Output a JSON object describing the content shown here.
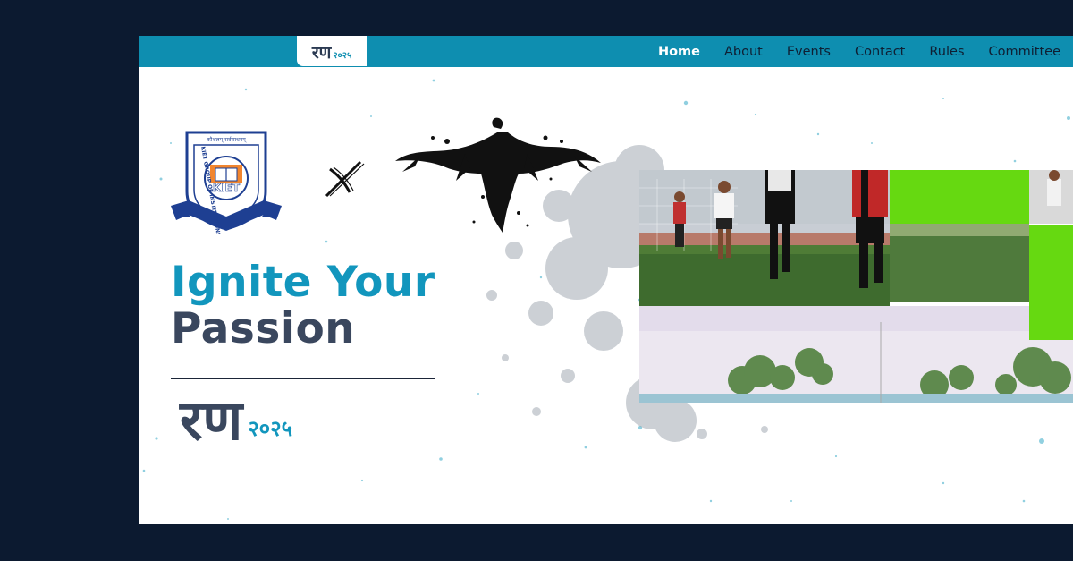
{
  "brand": {
    "name_main": "रण",
    "name_year": "२०२५"
  },
  "nav": {
    "items": [
      {
        "label": "Home",
        "active": true
      },
      {
        "label": "About"
      },
      {
        "label": "Events"
      },
      {
        "label": "Contact"
      },
      {
        "label": "Rules"
      },
      {
        "label": "Committee"
      }
    ]
  },
  "logos": {
    "college_motto": "कौशलम् सर्वसाधनम्",
    "college_ring_text": "KIET GROUP OF INSTITUTIONS",
    "college_abbr": "KIET",
    "college_icon": "kiet-emblem-icon",
    "collab_icon": "x-cross-icon",
    "partner_icon": "eagle-icon"
  },
  "hero": {
    "line1": "Ignite Your",
    "line2": "Passion",
    "event_main": "रण",
    "event_year": "२०२५"
  },
  "colors": {
    "page_bg": "#0c1a30",
    "nav_bg": "#0e8eb0",
    "accent": "#1296bd",
    "heading_dark": "#3a475e",
    "green_screen": "#66d911"
  }
}
